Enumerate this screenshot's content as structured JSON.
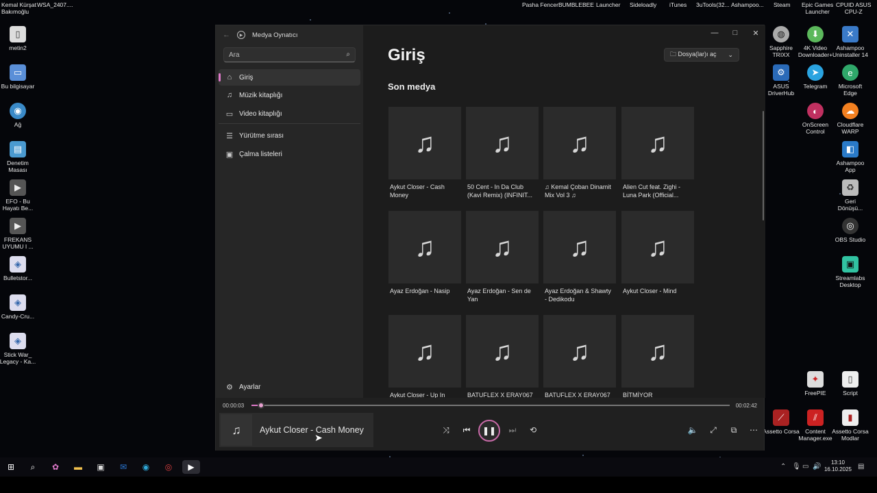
{
  "desktop": {
    "top_labels": [
      "Kemal Kürşat\nBakımoğlu",
      "WSA_2407....",
      "Pasha Fencer",
      "BUMBLEBEE",
      "Launcher",
      "Sideloadly",
      "iTunes",
      "3uTools(32...",
      "Ashampoo...",
      "Steam",
      "Epic Games\nLauncher",
      "CPUID ASUS\nCPU-Z"
    ],
    "left_icons": [
      "metin2",
      "Bu bilgisayar",
      "Ağ",
      "Denetim\nMasası",
      "EFO - Bu\nHayatı Be...",
      "FREKANS\nUYUMU I ...",
      "Bulletstor...",
      "Candy-Cru...",
      "Stick War_\nLegacy - Ka..."
    ],
    "right_icons": [
      "Sapphire\nTRIXX",
      "4K Video\nDownloader+",
      "Ashampoo\nUninstaller 14",
      "ASUS\nDriverHub",
      "Telegram",
      "Microsoft\nEdge",
      "OnScreen\nControl",
      "Cloudflare\nWARP",
      "Ashampoo\nApp",
      "Geri\nDönüşü...",
      "OBS Studio",
      "Streamlabs\nDesktop",
      "FreePIE",
      "Script",
      "Assetto Corsa",
      "Content\nManager.exe",
      "Assetto Corsa\nModlar"
    ]
  },
  "app": {
    "title": "Medya Oynatıcı",
    "search_placeholder": "Ara",
    "nav": [
      {
        "label": "Giriş",
        "icon": "⌂"
      },
      {
        "label": "Müzik kitaplığı",
        "icon": "♫"
      },
      {
        "label": "Video kitaplığı",
        "icon": "▭"
      },
      {
        "label": "Yürütme sırası",
        "icon": "☰"
      },
      {
        "label": "Çalma listeleri",
        "icon": "▣"
      }
    ],
    "settings_label": "Ayarlar",
    "page_title": "Giriş",
    "open_files_label": "Dosya(lar)ı aç",
    "section_title": "Son medya",
    "recent_media": [
      "Aykut Closer - Cash Money",
      "50 Cent - In Da Club (Kavi Remix) (INFINIT...",
      "♫ Kemal Çoban Dinamit Mix Vol 3 ♫",
      "Alien Cut feat. Zighi - Luna Park (Official...",
      "Ayaz Erdoğan - Nasip",
      "Ayaz Erdoğan - Sen de Yan",
      "Ayaz Erdoğan & Shawty - Dedikodu",
      "Aykut Closer - Mind",
      "Aykut Closer - Up In",
      "BATUFLEX X ERAY067 &",
      "BATUFLEX X ERAY067 &",
      "BİTMİYOR"
    ]
  },
  "player": {
    "elapsed": "00:00:03",
    "total": "00:02:42",
    "progress": 0.02,
    "now_playing": "Aykut Closer - Cash Money"
  },
  "taskbar": {
    "time": "13:10",
    "date": "16.10.2025"
  },
  "colors": {
    "accent": "#e07acb"
  }
}
